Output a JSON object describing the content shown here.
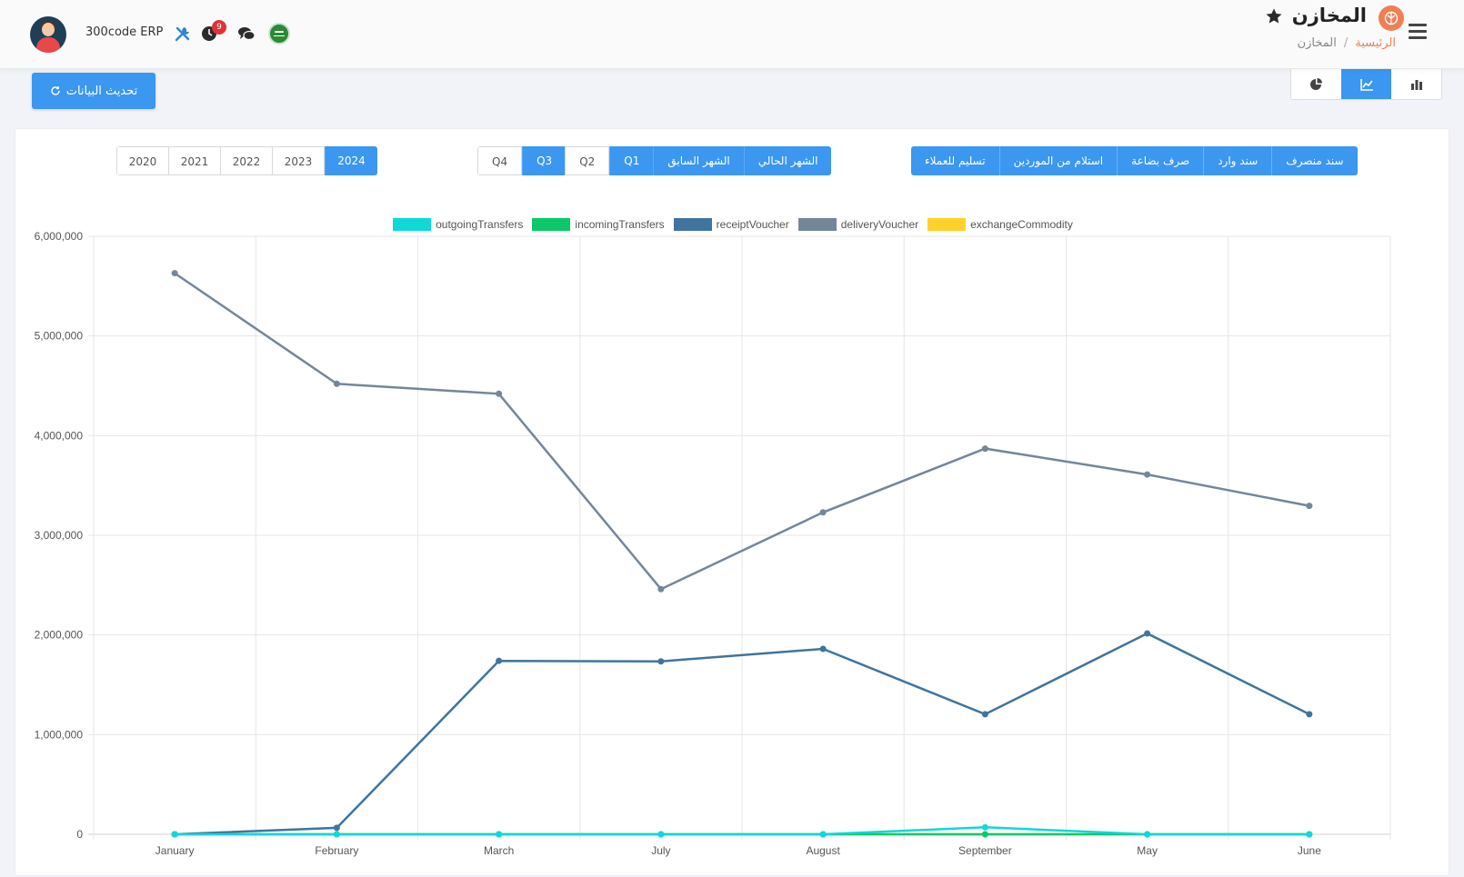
{
  "header": {
    "app_name": "300code ERP",
    "notif_count": "9",
    "page_title": "المخازن",
    "breadcrumb": {
      "home": "الرئيسية",
      "sep": "/",
      "current": "المخازن"
    }
  },
  "toolbar": {
    "refresh_label": "تحديث البيانات",
    "chart_types": [
      "pie-chart",
      "line-chart",
      "bar-chart"
    ],
    "active_chart_type": "line-chart"
  },
  "filters": {
    "years": [
      "2020",
      "2021",
      "2022",
      "2023",
      "2024"
    ],
    "active_year": "2024",
    "periods": [
      {
        "label": "Q4",
        "active": false
      },
      {
        "label": "Q3",
        "active": true
      },
      {
        "label": "Q2",
        "active": false
      },
      {
        "label": "Q1",
        "active": true
      },
      {
        "label": "الشهر السابق",
        "active": true
      },
      {
        "label": "الشهر الحالي",
        "active": true
      }
    ],
    "voucher_types": [
      "تسليم للعملاء",
      "استلام من الموردين",
      "صرف بضاعة",
      "سند وارد",
      "سند منصرف"
    ]
  },
  "colors": {
    "accent": "#3b97f0",
    "brand": "#f07f55"
  },
  "chart_data": {
    "type": "line",
    "categories": [
      "January",
      "February",
      "March",
      "July",
      "August",
      "September",
      "May",
      "June"
    ],
    "ylim": [
      0,
      6000000
    ],
    "y_ticks": [
      "0",
      "1,000,000",
      "2,000,000",
      "3,000,000",
      "4,000,000",
      "5,000,000",
      "6,000,000"
    ],
    "grid": true,
    "legend_position": "top",
    "series": [
      {
        "name": "outgoingTransfers",
        "color": "#0fd8d8",
        "values": [
          0,
          0,
          0,
          0,
          0,
          70000,
          0,
          0
        ]
      },
      {
        "name": "incomingTransfers",
        "color": "#0bc96b",
        "values": [
          0,
          0,
          0,
          0,
          0,
          0,
          0,
          0
        ]
      },
      {
        "name": "receiptVoucher",
        "color": "#40749f",
        "values": [
          0,
          65000,
          1740000,
          1735000,
          1860000,
          1205000,
          2015000,
          1205000
        ]
      },
      {
        "name": "deliveryVoucher",
        "color": "#758699",
        "values": [
          0,
          4520000,
          4420000,
          2460000,
          3230000,
          3870000,
          3610000,
          3295000
        ],
        "first": 5630000
      },
      {
        "name": "exchangeCommodity",
        "color": "#ffd229",
        "values": [
          0,
          0,
          0,
          0,
          0,
          0,
          0,
          0
        ]
      }
    ]
  }
}
